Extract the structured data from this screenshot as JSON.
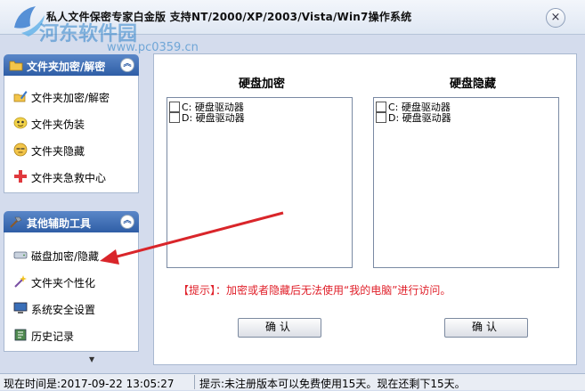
{
  "window": {
    "title": "私人文件保密专家白金版  支持NT/2000/XP/2003/Vista/Win7操作系统",
    "close_label": "×"
  },
  "watermark": {
    "text": "河东软件园",
    "url": "www.pc0359.cn"
  },
  "sidebar": {
    "panel1": {
      "title": "文件夹加密/解密",
      "collapse_icon": "double-chevron-up-icon",
      "items": [
        {
          "label": "文件夹加密/解密",
          "icon": "folder-pen-icon"
        },
        {
          "label": "文件夹伪装",
          "icon": "mask-icon"
        },
        {
          "label": "文件夹隐藏",
          "icon": "hidden-face-icon"
        },
        {
          "label": "文件夹急救中心",
          "icon": "red-cross-icon"
        }
      ]
    },
    "panel2": {
      "title": "其他辅助工具",
      "collapse_icon": "double-chevron-up-icon",
      "items": [
        {
          "label": "磁盘加密/隐藏",
          "icon": "disk-icon"
        },
        {
          "label": "文件夹个性化",
          "icon": "magic-wand-icon"
        },
        {
          "label": "系统安全设置",
          "icon": "monitor-icon"
        },
        {
          "label": "历史记录",
          "icon": "history-icon"
        }
      ]
    },
    "scroll_down_glyph": "▼"
  },
  "main": {
    "encrypt": {
      "title": "硬盘加密",
      "drives": [
        "C: 硬盘驱动器",
        "D: 硬盘驱动器"
      ],
      "button": "确认"
    },
    "hide": {
      "title": "硬盘隐藏",
      "drives": [
        "C: 硬盘驱动器",
        "D: 硬盘驱动器"
      ],
      "button": "确认"
    },
    "tip": "【提示】：加密或者隐藏后无法使用“我的电脑”进行访问。"
  },
  "statusbar": {
    "time": "现在时间是:2017-09-22 13:05:27",
    "message": "提示:未注册版本可以免费使用15天。现在还剩下15天。"
  },
  "colors": {
    "panel_header": "#2f5ea6",
    "tip_text": "#e0202a",
    "annotation_arrow": "#d9252a"
  }
}
